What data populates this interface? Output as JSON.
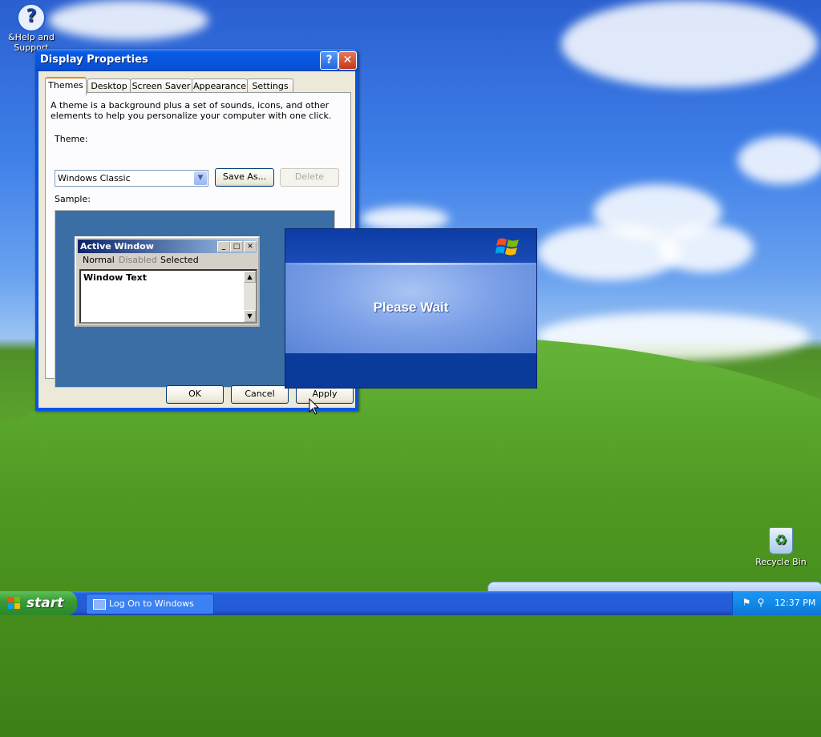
{
  "desktop": {
    "icons": [
      {
        "label": "&Help and Support",
        "icon": "help-icon"
      },
      {
        "label": "Recycle Bin",
        "icon": "recycle-bin-icon"
      }
    ]
  },
  "display_properties": {
    "title": "Display Properties",
    "tabs": [
      "Themes",
      "Desktop",
      "Screen Saver",
      "Appearance",
      "Settings"
    ],
    "active_tab": "Themes",
    "description": "A theme is a background plus a set of sounds, icons, and other elements to help you personalize your computer with one click.",
    "theme_label": "Theme:",
    "theme_value": "Windows Classic",
    "save_as_label": "Save As...",
    "delete_label": "Delete",
    "sample_label": "Sample:",
    "sample_window": {
      "title": "Active Window",
      "menu_normal": "Normal",
      "menu_disabled": "Disabled",
      "menu_selected": "Selected",
      "text": "Window Text"
    },
    "ok_label": "OK",
    "cancel_label": "Cancel",
    "apply_label": "Apply"
  },
  "please_wait": {
    "message": "Please Wait"
  },
  "taskbar": {
    "start_label": "start",
    "tasks": [
      {
        "label": "Log On to Windows"
      }
    ],
    "clock": "12:37 PM"
  },
  "colors": {
    "xp_blue": "#0a54e3",
    "start_green": "#3c9b35",
    "classic_desktop": "#3a6ea5"
  }
}
